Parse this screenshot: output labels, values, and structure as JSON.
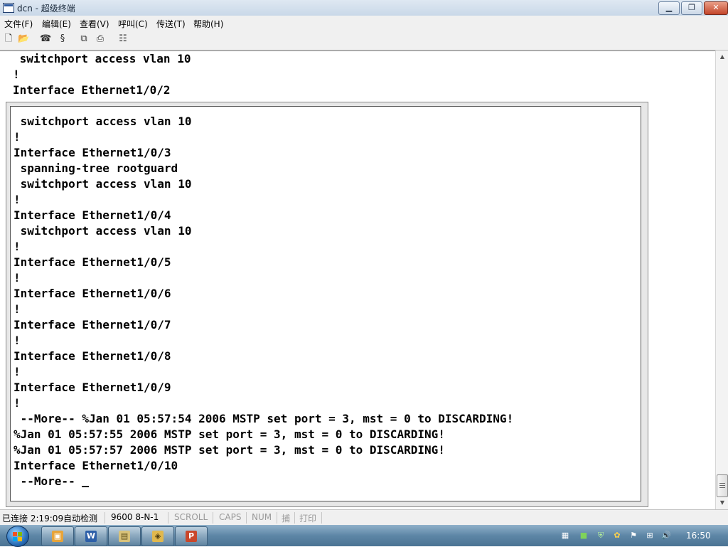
{
  "window": {
    "title": "dcn - 超级终端"
  },
  "menu": [
    "文件(F)",
    "编辑(E)",
    "查看(V)",
    "呼叫(C)",
    "传送(T)",
    "帮助(H)"
  ],
  "toolbar_icons": [
    "new-document-icon",
    "open-folder-icon",
    "call-phone-icon",
    "disconnect-icon",
    "send-icon",
    "receive-icon",
    "properties-icon"
  ],
  "terminal": {
    "background_lines": [
      " switchport access vlan 10",
      "!",
      "Interface Ethernet1/0/2"
    ],
    "popup_lines": [
      " switchport access vlan 10",
      "!",
      "Interface Ethernet1/0/3",
      " spanning-tree rootguard",
      " switchport access vlan 10",
      "!",
      "Interface Ethernet1/0/4",
      " switchport access vlan 10",
      "!",
      "Interface Ethernet1/0/5",
      "!",
      "Interface Ethernet1/0/6",
      "!",
      "Interface Ethernet1/0/7",
      "!",
      "Interface Ethernet1/0/8",
      "!",
      "Interface Ethernet1/0/9",
      "!",
      " --More-- %Jan 01 05:57:54 2006 MSTP set port = 3, mst = 0 to DISCARDING!",
      "%Jan 01 05:57:55 2006 MSTP set port = 3, mst = 0 to DISCARDING!",
      "%Jan 01 05:57:57 2006 MSTP set port = 3, mst = 0 to DISCARDING!",
      "Interface Ethernet1/0/10",
      " --More-- "
    ]
  },
  "statusbar": {
    "connection": "已连接 2:19:09",
    "detect": "自动检测",
    "settings": "9600 8-N-1",
    "scroll": "SCROLL",
    "caps": "CAPS",
    "num": "NUM",
    "capture": "捕",
    "print": "打印"
  },
  "taskbar": {
    "clock": "16:50",
    "colors": {
      "accent": "#2a6fb8"
    }
  }
}
